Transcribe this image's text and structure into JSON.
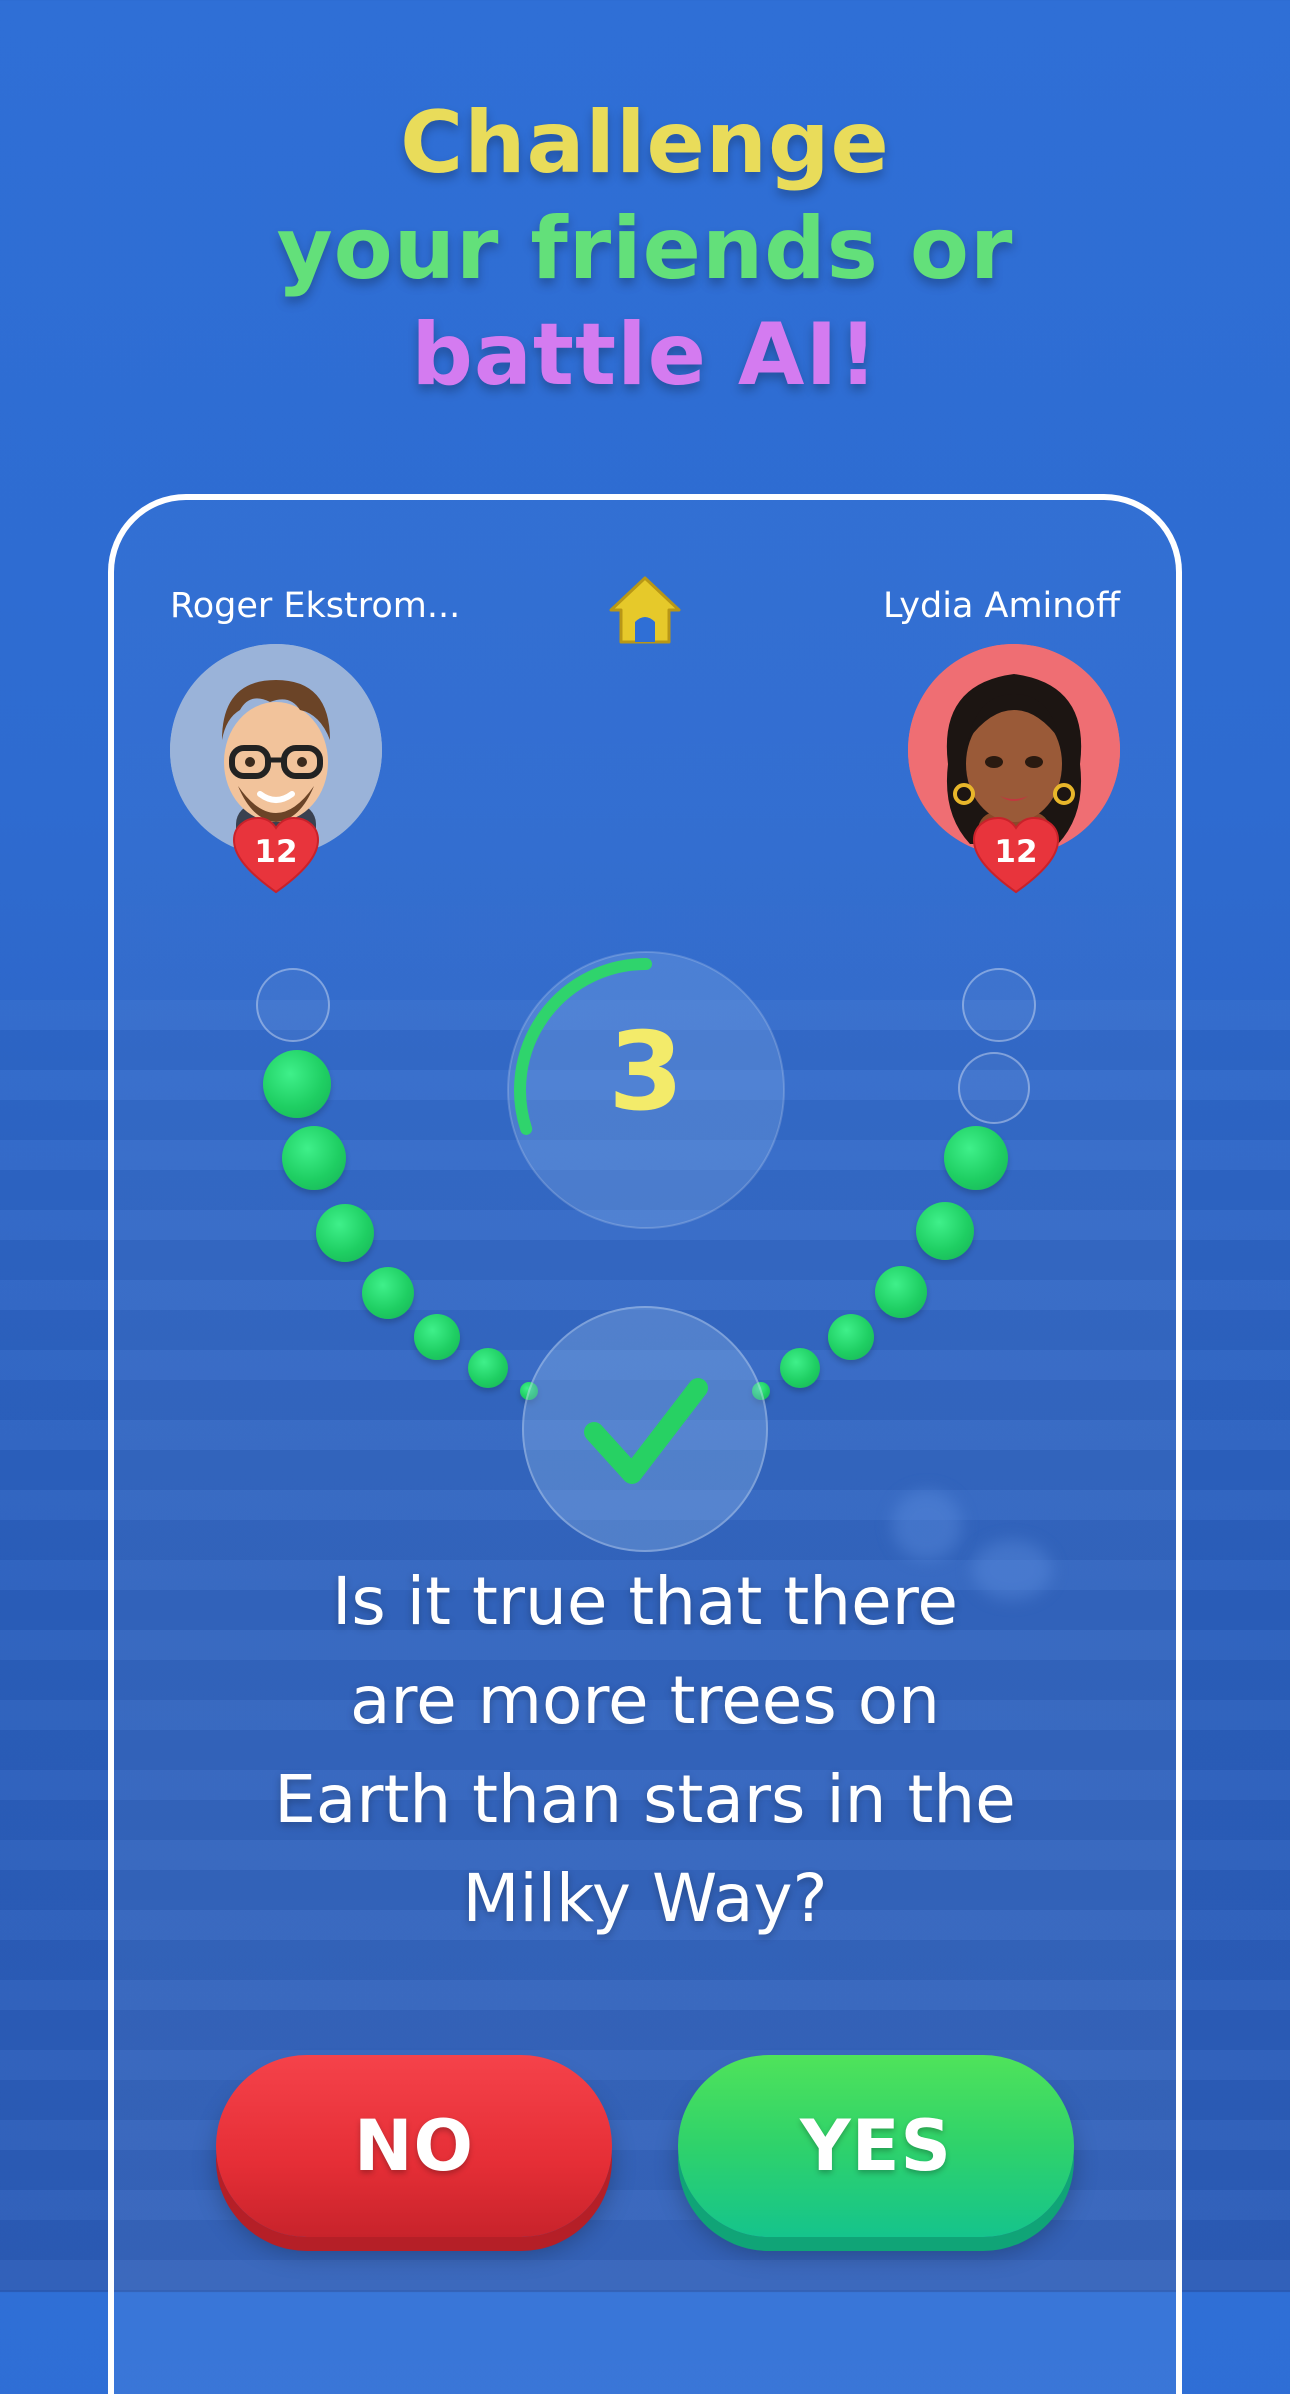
{
  "headline": {
    "line1": "Challenge",
    "line2": "your friends or",
    "line3": "battle AI!"
  },
  "players": {
    "left": {
      "name": "Roger Ekstrom...",
      "lives": "12"
    },
    "right": {
      "name": "Lydia Aminoff",
      "lives": "12"
    }
  },
  "timer": {
    "value": "3",
    "progress": 0.3
  },
  "question": {
    "line1": "Is it true that there",
    "line2": "are more trees on",
    "line3": "Earth than stars in the",
    "line4": "Milky Way?"
  },
  "buttons": {
    "no": "NO",
    "yes": "YES"
  },
  "colors": {
    "headline_yellow": "#e9dc5a",
    "headline_green": "#63e07a",
    "headline_purple": "#d47bf0",
    "no_red": "#e52e36",
    "yes_green": "#2fd26b",
    "timer_yellow": "#f3eb6a"
  },
  "icons": {
    "home": "home-icon",
    "heart": "heart-icon",
    "check": "check-icon"
  }
}
